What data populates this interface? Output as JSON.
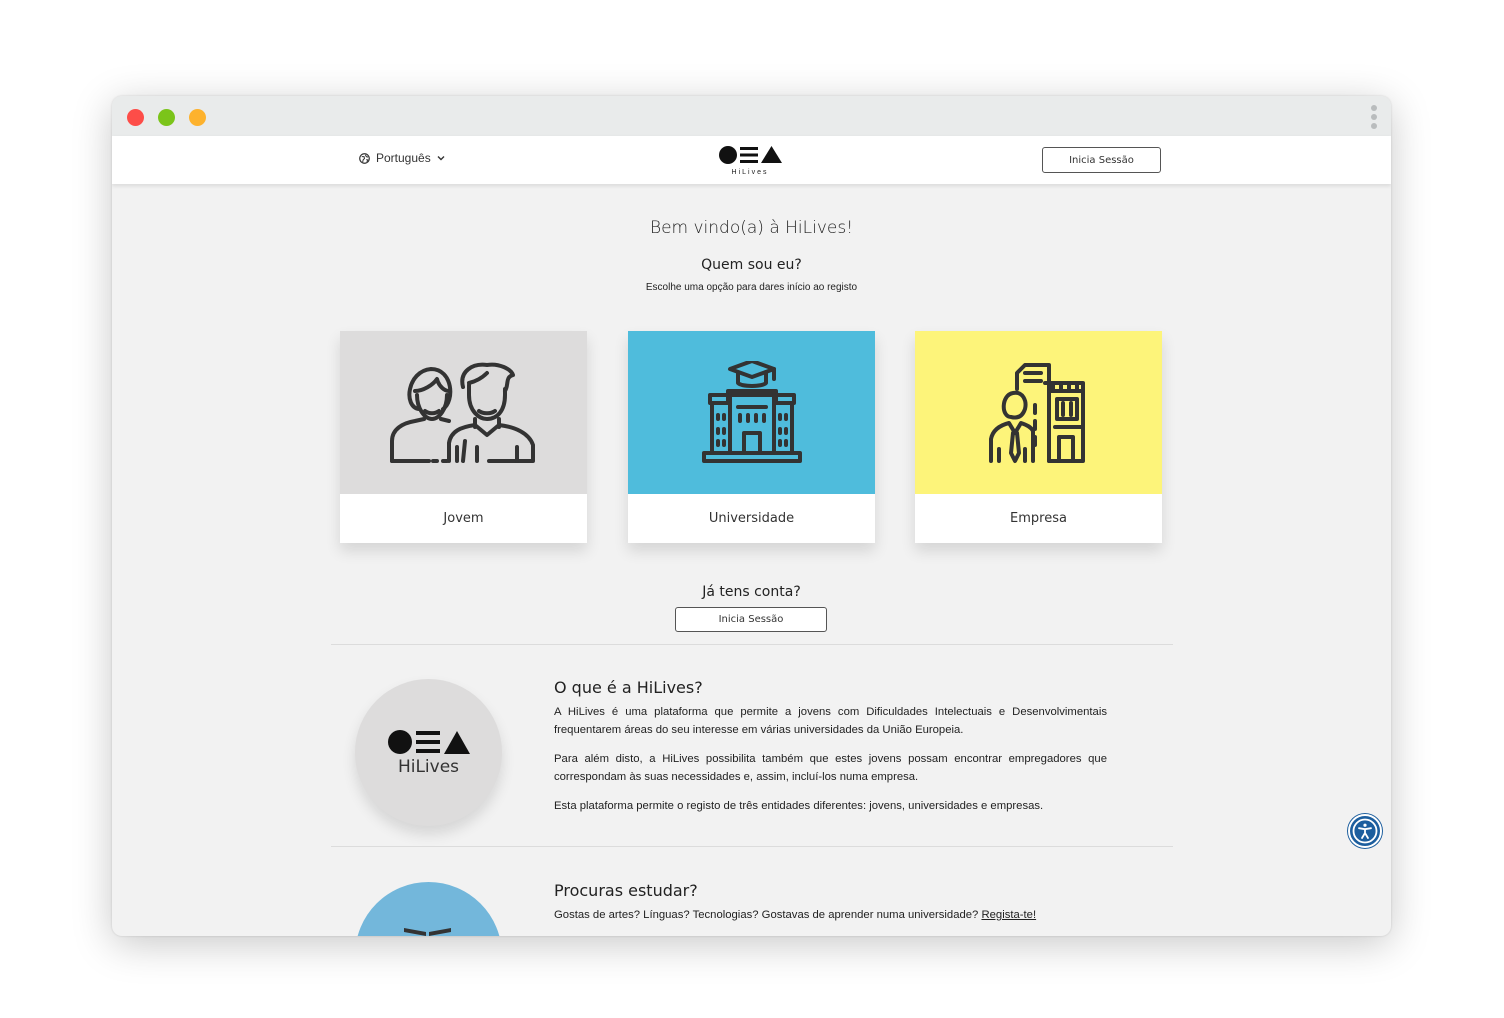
{
  "nav": {
    "language_label": "Português",
    "logo_text": "HiLives",
    "login_label": "Inicia Sessão"
  },
  "hero": {
    "welcome": "Bem vindo(a) à HiLives!",
    "who_am_i": "Quem sou eu?",
    "instruction": "Escolhe uma opção para dares início ao registo"
  },
  "cards": [
    {
      "label": "Jovem",
      "color": "#dddcdc",
      "icon": "young-people-icon"
    },
    {
      "label": "Universidade",
      "color": "#4fbcdc",
      "icon": "university-icon"
    },
    {
      "label": "Empresa",
      "color": "#fdf47a",
      "icon": "company-icon"
    }
  ],
  "account": {
    "question": "Já tens conta?",
    "login_label": "Inicia Sessão"
  },
  "about": {
    "logo_text": "HiLives",
    "title": "O que é a HiLives?",
    "paragraphs": [
      "A HiLives é uma plataforma que permite a jovens com Dificuldades Intelectuais e Desenvolvimentais frequentarem áreas do seu interesse em várias universidades da União Europeia.",
      "Para além disto, a HiLives possibilita também que estes jovens possam encontrar empregadores que correspondam às suas necessidades e, assim, incluí-los numa empresa.",
      "Esta plataforma permite o registo de três entidades diferentes: jovens, universidades e empresas."
    ]
  },
  "study": {
    "title": "Procuras estudar?",
    "text": "Gostas de artes? Línguas? Tecnologias? Gostavas de aprender numa universidade? ",
    "link": "Regista-te!"
  },
  "colors": {
    "accessibility_button": "#1c5e9e",
    "study_circle": "#73b7db"
  }
}
